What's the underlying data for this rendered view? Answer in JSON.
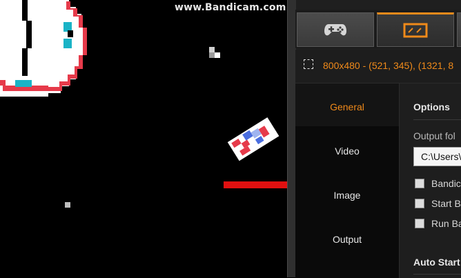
{
  "watermark": "www.Bandicam.com",
  "panel": {
    "tabs": [
      {
        "icon": "gamepad-icon",
        "active": false
      },
      {
        "icon": "screen-rectangle-icon",
        "active": true
      }
    ],
    "capture_info": "800x480 - (521, 345), (1321, 8",
    "sidebar": [
      {
        "label": "General",
        "active": true
      },
      {
        "label": "Video",
        "active": false
      },
      {
        "label": "Image",
        "active": false
      },
      {
        "label": "Output",
        "active": false
      }
    ],
    "options": {
      "title": "Options",
      "output_folder_label": "Output fol",
      "output_folder_value": "C:\\Users\\",
      "checkboxes": [
        "Bandic",
        "Start B",
        "Run Ba"
      ],
      "auto_start_title": "Auto Start"
    }
  },
  "colors": {
    "accent": "#f08a1a",
    "player_red": "#e63a4a",
    "cyan": "#1ab3c6",
    "bar_red": "#e01010"
  }
}
